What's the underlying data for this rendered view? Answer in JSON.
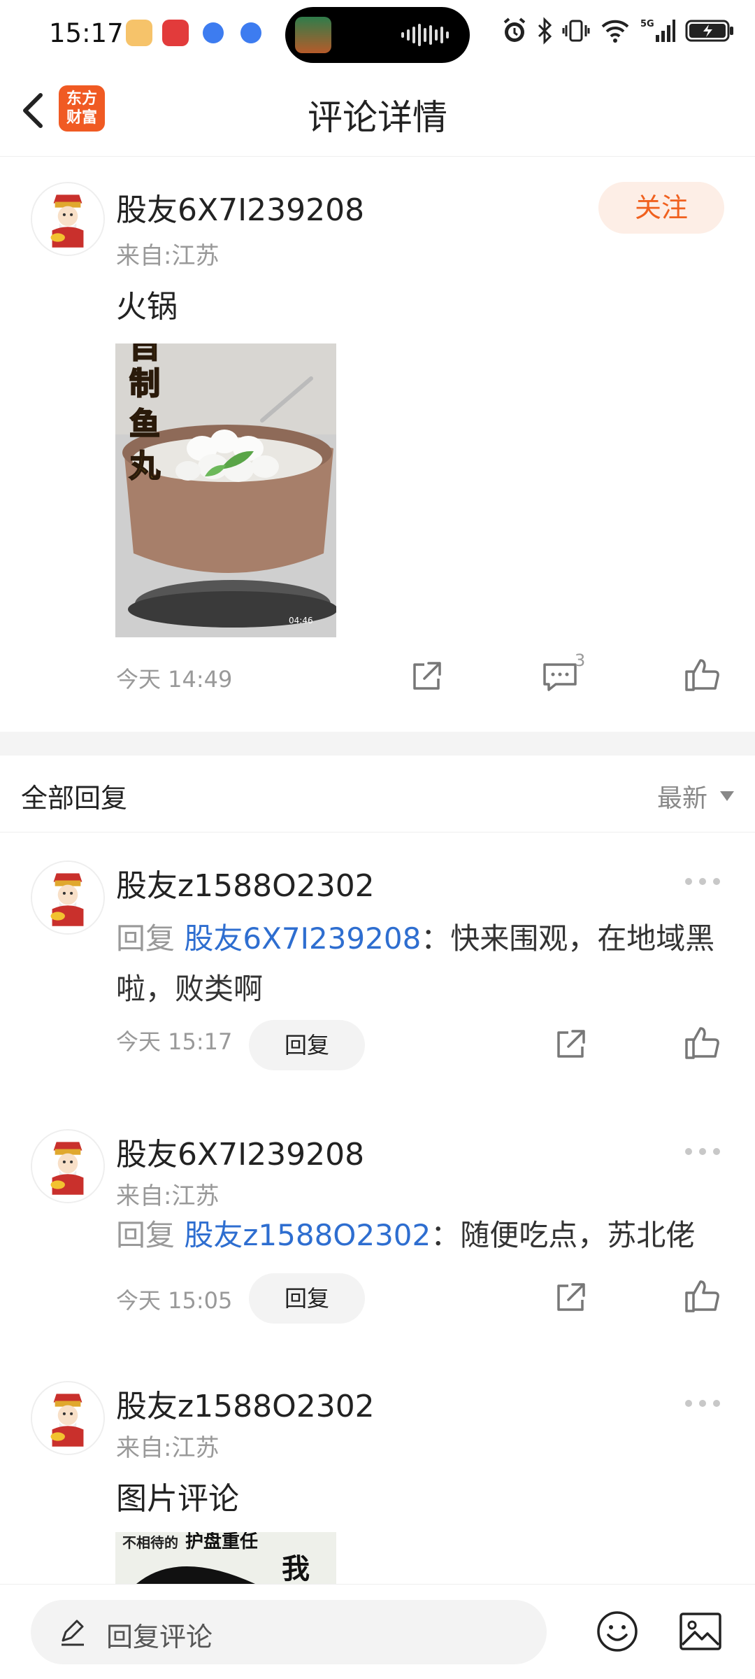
{
  "status_bar": {
    "time": "15:17"
  },
  "header": {
    "title": "评论详情",
    "logo_text_line1": "东方",
    "logo_text_line2": "财富"
  },
  "post": {
    "username": "股友6X7I239208",
    "location": "来自:江苏",
    "text": "火锅",
    "follow_label": "关注",
    "image_caption": "自制鱼丸",
    "image_duration": "04:46",
    "time": "今天 14:49",
    "comment_count": "3"
  },
  "replies_section": {
    "title": "全部回复",
    "sort_label": "最新"
  },
  "replies": [
    {
      "username": "股友z1588O2302",
      "prefix": "回复 ",
      "mention": "股友6X7I239208",
      "content": "：快来围观，在地域黑啦，败类啊",
      "time": "今天 15:17",
      "reply_label": "回复"
    },
    {
      "username": "股友6X7I239208",
      "location": "来自:江苏",
      "prefix": "回复 ",
      "mention": "股友z1588O2302",
      "content": "：随便吃点，苏北佬",
      "time": "今天 15:05",
      "reply_label": "回复"
    },
    {
      "username": "股友z1588O2302",
      "location": "来自:江苏",
      "content": "图片评论",
      "image_caption": "不相待的 护盘重任 我"
    }
  ],
  "bottom_bar": {
    "placeholder": "回复评论"
  },
  "icons": {
    "back": "back-icon",
    "share": "share-icon",
    "comment": "comment-icon",
    "like": "thumbs-up-icon",
    "more": "more-icon",
    "pencil": "pencil-icon",
    "emoji": "emoji-icon",
    "image": "image-icon"
  },
  "colors": {
    "accent": "#f0611f",
    "mention": "#2e6ed0",
    "follow_bg": "#fdeee6"
  }
}
